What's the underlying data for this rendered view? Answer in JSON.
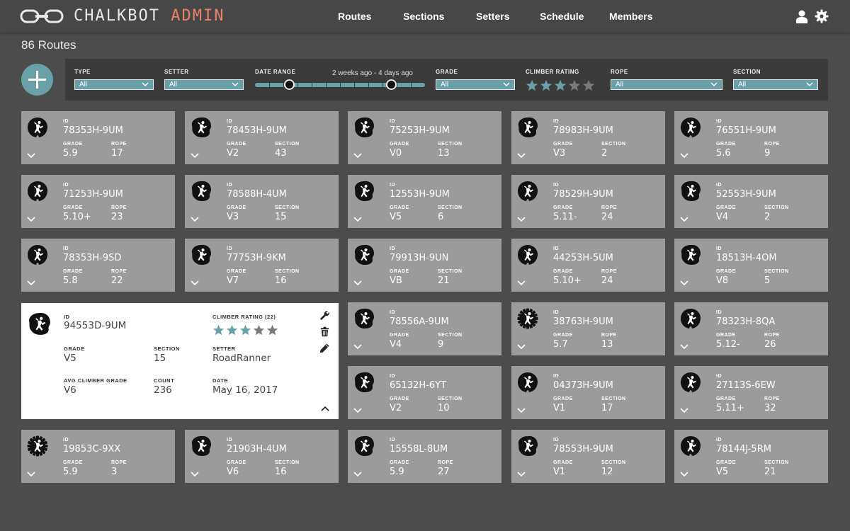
{
  "header": {
    "brand_primary": "CHALKBOT",
    "brand_secondary": "ADMIN",
    "nav": [
      "Routes",
      "Sections",
      "Setters",
      "Schedule",
      "Members"
    ],
    "user_icon": "user-icon",
    "settings_icon": "gear-icon"
  },
  "page": {
    "title": "86 Routes"
  },
  "filters": {
    "type": {
      "label": "TYPE",
      "value": "All"
    },
    "setter": {
      "label": "SETTER",
      "value": "All"
    },
    "date_range": {
      "label": "DATE RANGE",
      "value": "2 weeks ago - 4 days ago",
      "start": 0.2,
      "end": 0.8
    },
    "grade": {
      "label": "GRADE",
      "value": "All"
    },
    "climber_rating": {
      "label": "CLIMBER RATING",
      "stars": 3,
      "max": 5
    },
    "rope": {
      "label": "ROPE",
      "value": "All"
    },
    "section": {
      "label": "SECTION",
      "value": "All"
    }
  },
  "card_labels": {
    "id": "ID",
    "grade": "GRADE",
    "rope": "ROPE",
    "section": "SECTION"
  },
  "routes": [
    {
      "id": "78353H-9UM",
      "grade": "5.9",
      "k2": "ROPE",
      "v2": "17",
      "icon": "rope"
    },
    {
      "id": "78453H-9UM",
      "grade": "V2",
      "k2": "SECTION",
      "v2": "43",
      "icon": "boulder"
    },
    {
      "id": "75253H-9UM",
      "grade": "V0",
      "k2": "SECTION",
      "v2": "13",
      "icon": "boulder"
    },
    {
      "id": "78983H-9UM",
      "grade": "V3",
      "k2": "SECTION",
      "v2": "2",
      "icon": "boulder"
    },
    {
      "id": "76551H-9UM",
      "grade": "5.6",
      "k2": "ROPE",
      "v2": "9",
      "icon": "rope"
    },
    {
      "id": "71253H-9UM",
      "grade": "5.10+",
      "k2": "ROPE",
      "v2": "23",
      "icon": "rope"
    },
    {
      "id": "78588H-4UM",
      "grade": "V3",
      "k2": "SECTION",
      "v2": "15",
      "icon": "boulder"
    },
    {
      "id": "12553H-9UM",
      "grade": "V5",
      "k2": "SECTION",
      "v2": "6",
      "icon": "boulder"
    },
    {
      "id": "78529H-9UM",
      "grade": "5.11-",
      "k2": "ROPE",
      "v2": "24",
      "icon": "rope"
    },
    {
      "id": "52553H-9UM",
      "grade": "V4",
      "k2": "SECTION",
      "v2": "2",
      "icon": "boulder"
    },
    {
      "id": "78353H-9SD",
      "grade": "5.8",
      "k2": "ROPE",
      "v2": "22",
      "icon": "rope"
    },
    {
      "id": "77753H-9KM",
      "grade": "V7",
      "k2": "SECTION",
      "v2": "16",
      "icon": "boulder"
    },
    {
      "id": "79913H-9UN",
      "grade": "VB",
      "k2": "SECTION",
      "v2": "21",
      "icon": "boulder"
    },
    {
      "id": "44253H-5UM",
      "grade": "5.10+",
      "k2": "ROPE",
      "v2": "24",
      "icon": "rope"
    },
    {
      "id": "18513H-4OM",
      "grade": "V8",
      "k2": "SECTION",
      "v2": "5",
      "icon": "boulder"
    },
    {
      "id": "78556A-9UM",
      "grade": "V4",
      "k2": "SECTION",
      "v2": "9",
      "icon": "boulder"
    },
    {
      "id": "38763H-9UM",
      "grade": "5.7",
      "k2": "ROPE",
      "v2": "13",
      "icon": "gear"
    },
    {
      "id": "78323H-8QA",
      "grade": "5.12-",
      "k2": "ROPE",
      "v2": "26",
      "icon": "rope"
    },
    {
      "id": "65132H-6YT",
      "grade": "V2",
      "k2": "SECTION",
      "v2": "10",
      "icon": "boulder"
    },
    {
      "id": "04373H-9UM",
      "grade": "V1",
      "k2": "SECTION",
      "v2": "17",
      "icon": "rope"
    },
    {
      "id": "27113S-6EW",
      "grade": "5.11+",
      "k2": "ROPE",
      "v2": "32",
      "icon": "rope"
    },
    {
      "id": "19853C-9XX",
      "grade": "5.9",
      "k2": "ROPE",
      "v2": "3",
      "icon": "gear"
    },
    {
      "id": "21903H-4UM",
      "grade": "V6",
      "k2": "SECTION",
      "v2": "16",
      "icon": "boulder"
    },
    {
      "id": "15558L-8UM",
      "grade": "5.9",
      "k2": "ROPE",
      "v2": "27",
      "icon": "boulder"
    },
    {
      "id": "78553H-9UM",
      "grade": "V1",
      "k2": "SECTION",
      "v2": "12",
      "icon": "boulder"
    },
    {
      "id": "78144J-5RM",
      "grade": "V5",
      "k2": "SECTION",
      "v2": "21",
      "icon": "rope"
    }
  ],
  "expanded": {
    "id_label": "ID",
    "id": "94553D-9UM",
    "rating_label": "CLIMBER RATING (22)",
    "rating": 3,
    "rating_max": 5,
    "grade_label": "GRADE",
    "grade": "V5",
    "section_label": "SECTION",
    "section": "15",
    "setter_label": "SETTER",
    "setter": "RoadRanner",
    "avg_label": "AVG CLIMBER GRADE",
    "avg": "V6",
    "count_label": "COUNT",
    "count": "236",
    "date_label": "DATE",
    "date": "May 16, 2017",
    "icon": "boulder"
  },
  "colors": {
    "accent": "#6aa0a8",
    "brand_secondary": "#e8826a",
    "card": "#9b9b9b",
    "background": "#4c4c4c",
    "star_off": "#7a7a7a"
  }
}
